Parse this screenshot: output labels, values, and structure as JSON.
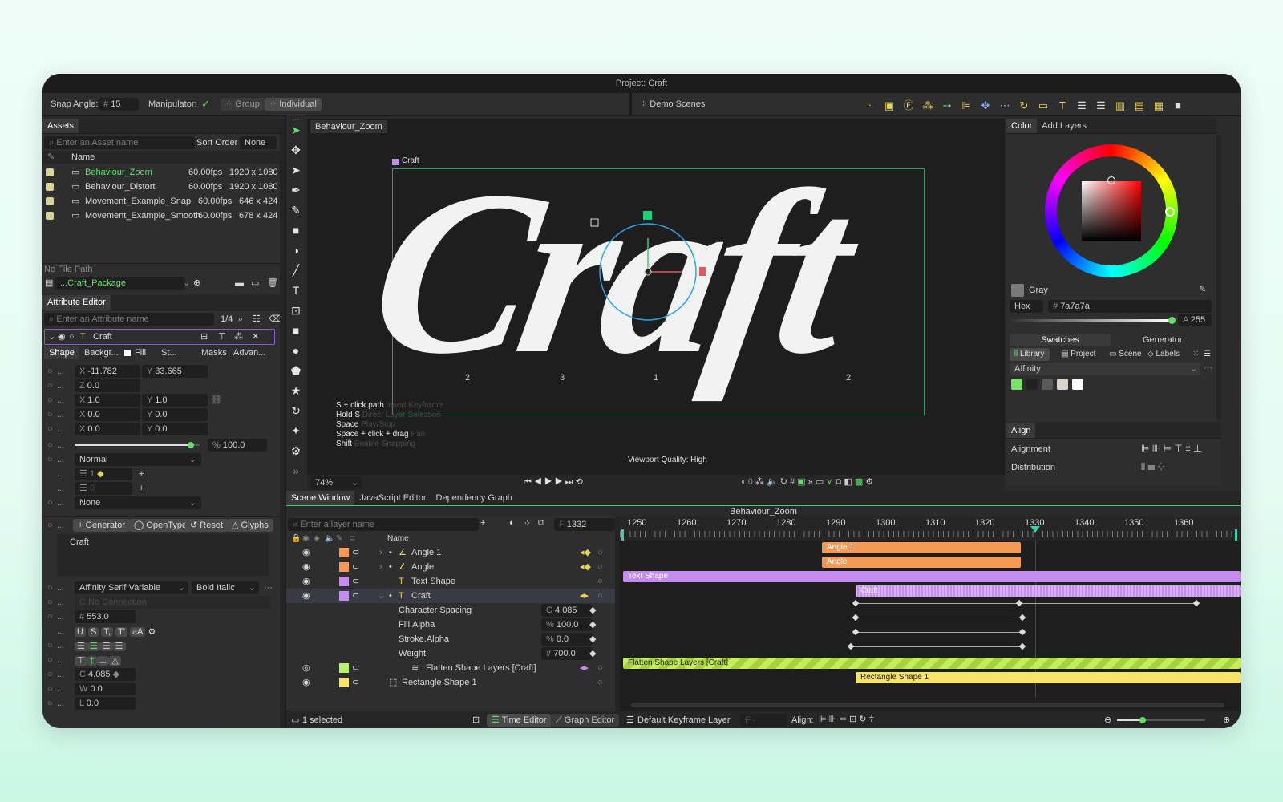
{
  "window": {
    "title": "Project: Craft"
  },
  "toolbar": {
    "snap_angle_label": "Snap Angle:",
    "snap_angle_prefix": "#",
    "snap_angle_value": "15",
    "manipulator_label": "Manipulator:",
    "group_label": "Group",
    "individual_label": "Individual",
    "scene_selector": "Demo Scenes"
  },
  "assets": {
    "tab": "Assets",
    "search_placeholder": "Enter an Asset name",
    "sort_label": "Sort Order",
    "sort_value": "None",
    "col_name": "Name",
    "items": [
      {
        "name": "Behaviour_Zoom",
        "fps": "60.00fps",
        "res": "1920 x 1080"
      },
      {
        "name": "Behaviour_Distort",
        "fps": "60.00fps",
        "res": "1920 x 1080"
      },
      {
        "name": "Movement_Example_Snap",
        "fps": "60.00fps",
        "res": "646 x 424"
      },
      {
        "name": "Movement_Example_Smooth",
        "fps": "60.00fps",
        "res": "678 x 424"
      }
    ],
    "file_path": "No File Path",
    "package": "...Craft_Package"
  },
  "attr": {
    "title": "Attribute Editor",
    "search_placeholder": "Enter an Attribute name",
    "page": "1/4",
    "layer_name": "Craft",
    "tabs": [
      "Shape",
      "Backgr...",
      "Fill",
      "St...",
      "Masks",
      "Advan..."
    ],
    "pos_x": "-11.782",
    "pos_y": "33.665",
    "z": "0.0",
    "scale_x": "1.0",
    "scale_y": "1.0",
    "skew_x": "0.0",
    "skew_y": "0.0",
    "pivot_x": "0.0",
    "pivot_y": "0.0",
    "opacity": "100.0",
    "opacity_fraction": 0.93,
    "blend": "Normal",
    "count1": "1",
    "count2": "0",
    "mask": "None",
    "buttons": [
      "Generator",
      "OpenType",
      "Reset",
      "Glyphs"
    ],
    "text_content": "Craft",
    "font": "Affinity Serif Variable",
    "style": "Bold Italic",
    "connection": "No Connection",
    "size": "553.0",
    "spacing": "4.085",
    "w": "0.0",
    "l": "0.0",
    "fmt_buttons": [
      "U",
      "S",
      "T,",
      "T'",
      "aA"
    ]
  },
  "viewport": {
    "tab": "Behaviour_Zoom",
    "layer_label": "Craft",
    "word": "Craft",
    "glyph_labels": [
      "2",
      "3",
      "1",
      "2"
    ],
    "hints": [
      {
        "key": "S + click path",
        "desc": "Insert Keyframe"
      },
      {
        "key": "Hold S",
        "desc": "Direct Layer Selection"
      },
      {
        "key": "Space",
        "desc": "Play/Stop"
      },
      {
        "key": "Space + click + drag",
        "desc": "Pan"
      },
      {
        "key": "Shift",
        "desc": "Enable Snapping"
      }
    ],
    "quality": "Viewport Quality: High",
    "zoom": "74%",
    "frame_zero": "0"
  },
  "color": {
    "tabs": [
      "Color",
      "Add Layers"
    ],
    "name": "Gray",
    "format": "Hex",
    "hex": "7a7a7a",
    "alpha_prefix": "A",
    "alpha": "255",
    "subtabs": [
      "Swatches",
      "Generator"
    ],
    "sources": [
      "Library",
      "Project",
      "Scene",
      "Labels"
    ],
    "palette": "Affinity",
    "swatches": [
      "#7be36a",
      "#222222",
      "#5a5a5a",
      "#d8d4cc",
      "#ffffff"
    ]
  },
  "align": {
    "title": "Align",
    "alignment": "Alignment",
    "distribution": "Distribution"
  },
  "scene": {
    "tabs": [
      "Scene Window",
      "JavaScript Editor",
      "Dependency Graph"
    ],
    "title": "Behaviour_Zoom",
    "search_placeholder": "Enter a layer name",
    "frame_prefix": "F",
    "frame": "1332",
    "col_name": "Name",
    "layers": [
      {
        "name": "Angle 1",
        "color": "#f59a55"
      },
      {
        "name": "Angle",
        "color": "#f59a55"
      },
      {
        "name": "Text Shape",
        "color": "#c58cf0"
      },
      {
        "name": "Craft",
        "color": "#c58cf0"
      },
      {
        "name": "Character Spacing",
        "value": "4.085",
        "prefix": "C"
      },
      {
        "name": "Fill.Alpha",
        "value": "100.0",
        "prefix": "%"
      },
      {
        "name": "Stroke.Alpha",
        "value": "0.0",
        "prefix": "%"
      },
      {
        "name": "Weight",
        "value": "700.0",
        "prefix": "#"
      },
      {
        "name": "Flatten Shape Layers [Craft]",
        "color": "#b6f26a"
      },
      {
        "name": "Rectangle Shape 1",
        "color": "#f5e46a"
      }
    ],
    "ruler": [
      "1250",
      "1260",
      "1270",
      "1280",
      "1290",
      "1300",
      "1310",
      "1320",
      "1330",
      "1340",
      "1350",
      "1360"
    ],
    "bars": {
      "angle1": "Angle 1",
      "angle": "Angle",
      "text_shape": "Text Shape",
      "craft": "Craft",
      "flatten": "Flatten Shape Layers [Craft]",
      "rect": "Rectangle Shape 1"
    },
    "status": "1 selected",
    "time_editor": "Time Editor",
    "graph_editor": "Graph Editor",
    "kf_layer": "Default Keyframe Layer",
    "kf_prefix": "F",
    "kf_value": "-",
    "align_label": "Align:"
  }
}
